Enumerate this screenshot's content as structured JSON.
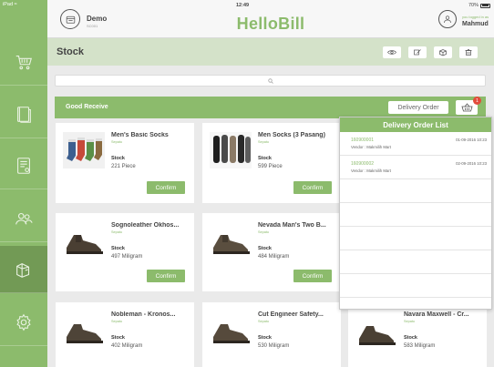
{
  "status_bar": {
    "device": "iPad",
    "time": "12:49",
    "battery": "70%"
  },
  "header": {
    "store_name": "Demo",
    "store_code": "SC001",
    "app_title": "HelloBill",
    "login_note": "you logged in as",
    "user_name": "Mahmud"
  },
  "sidebar": {
    "items": [
      {
        "icon": "cart-icon"
      },
      {
        "icon": "book-icon"
      },
      {
        "icon": "receipt-icon"
      },
      {
        "icon": "customers-icon"
      },
      {
        "icon": "stock-icon"
      },
      {
        "icon": "settings-icon"
      }
    ],
    "active_index": 4
  },
  "page": {
    "title": "Stock"
  },
  "toolbar": {
    "icons": [
      "eye-icon",
      "edit-icon",
      "box-icon",
      "trash-icon"
    ]
  },
  "good_receive": {
    "title": "Good Receive",
    "delivery_order_label": "Delivery Order",
    "basket_badge": "1"
  },
  "products": [
    {
      "name": "Men's Basic Socks",
      "category": "Sepatu",
      "stock_label": "Stock",
      "stock": "221 Piece",
      "confirm_label": "Confirm",
      "image": "socks-photo"
    },
    {
      "name": "Men Socks (3 Pasang)",
      "category": "Sepatu",
      "stock_label": "Stock",
      "stock": "599 Piece",
      "confirm_label": "Confirm",
      "image": "socks-photo"
    },
    {
      "name": "Sognoleather Okhos...",
      "category": "Sepatu",
      "stock_label": "Stock",
      "stock": "497 Miligram",
      "confirm_label": "Confirm",
      "image": "shoe-photo"
    },
    {
      "name": "Nevada Man's Two B...",
      "category": "Sepatu",
      "stock_label": "Stock",
      "stock": "484 Miligram",
      "confirm_label": "Confirm",
      "image": "shoe-photo"
    },
    {
      "name": "Nobleman - Kronos...",
      "category": "Sepatu",
      "stock_label": "Stock",
      "stock": "402 Miligram",
      "image": "shoe-photo"
    },
    {
      "name": "Cut Engineer Safety...",
      "category": "Sepatu",
      "stock_label": "Stock",
      "stock": "530 Miligram",
      "image": "shoe-photo"
    },
    {
      "name": "Navara Maxwell - Cr...",
      "category": "Sepatu",
      "stock_label": "Stock",
      "stock": "583 Miligram",
      "image": "shoe-photo"
    }
  ],
  "delivery_order_list": {
    "title": "Delivery Order List",
    "items": [
      {
        "number": "160900001",
        "date": "01-09-2016 10:23",
        "vendor": "Vendor : Makmilih Mart"
      },
      {
        "number": "160900002",
        "date": "02-09-2016 10:23",
        "vendor": "Vendor : Makmilih Mart"
      }
    ],
    "empty_rows": 5
  },
  "colors": {
    "accent": "#8cbb6c",
    "sidebar_active": "#729a55",
    "title_bar": "#d4e2c9",
    "badge": "#e24c3c",
    "background": "#eaeaea"
  }
}
